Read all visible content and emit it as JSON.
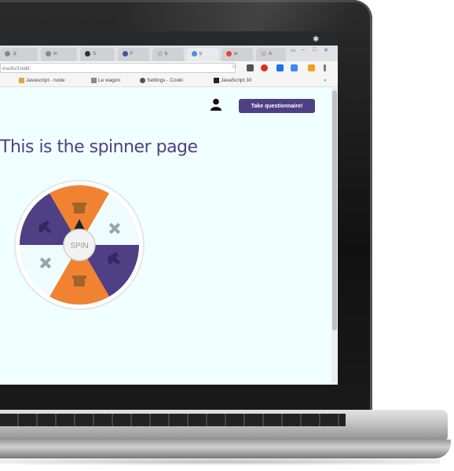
{
  "browser": {
    "tabs": [
      "J(",
      "In",
      "S",
      "F",
      "b",
      "b",
      "w",
      "A"
    ],
    "url": "esults/1/edit",
    "bookmarks": [
      "Javascript - node",
      "Le wagon",
      "Settings - Cooki",
      "JavaScript 30"
    ]
  },
  "page": {
    "cta_label": "Take questionnaire!",
    "title": "This is the spinner page",
    "spin_label": "SPIN"
  },
  "colors": {
    "brand_purple": "#4f3f84",
    "accent_orange": "#f08232",
    "page_bg": "#f0ffff"
  },
  "icons": {
    "wheel_segments": [
      "gift-icon",
      "plus-icon",
      "hand-icon",
      "gift-icon",
      "plus-icon",
      "hand-icon"
    ],
    "user": "user-icon"
  }
}
